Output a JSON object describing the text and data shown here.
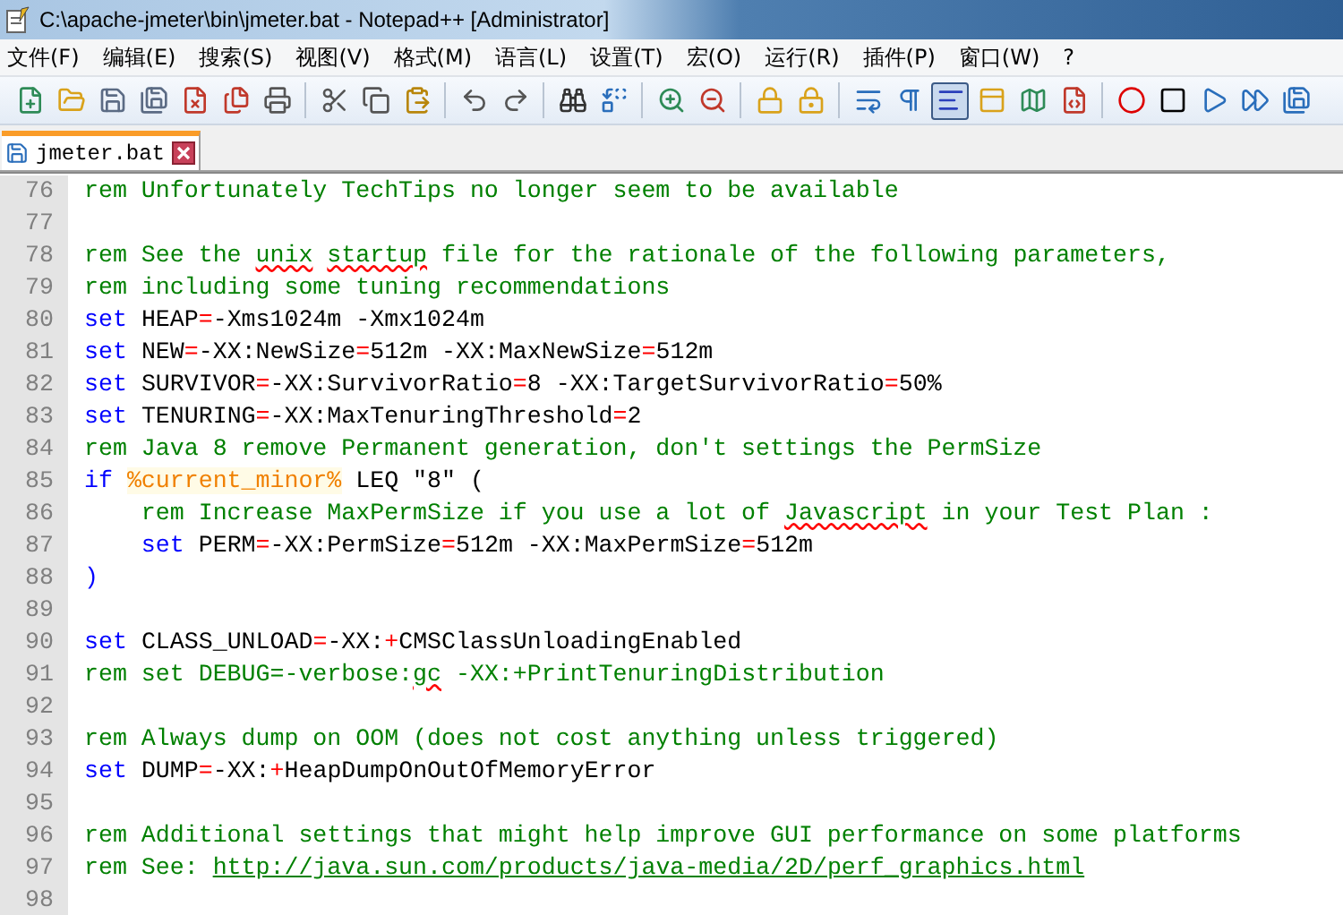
{
  "window": {
    "title": "C:\\apache-jmeter\\bin\\jmeter.bat - Notepad++ [Administrator]"
  },
  "menu": [
    "文件(F)",
    "编辑(E)",
    "搜索(S)",
    "视图(V)",
    "格式(M)",
    "语言(L)",
    "设置(T)",
    "宏(O)",
    "运行(R)",
    "插件(P)",
    "窗口(W)",
    "?"
  ],
  "toolbar": [
    {
      "selected": false
    },
    {
      "selected": false
    },
    {
      "selected": false
    },
    {
      "selected": false
    },
    {
      "selected": false
    },
    {
      "selected": false
    },
    {
      "selected": false
    },
    {
      "selected": false
    },
    {
      "selected": false
    },
    {
      "selected": false
    },
    {
      "selected": false
    },
    {
      "selected": false
    },
    {
      "selected": false
    },
    {
      "selected": false
    },
    {
      "selected": false
    },
    {
      "selected": false
    },
    {
      "selected": false
    },
    {
      "selected": false
    },
    {
      "selected": false
    },
    {
      "selected": false
    },
    {
      "selected": true
    },
    {
      "selected": false
    },
    {
      "selected": false
    },
    {
      "selected": false
    },
    {
      "selected": false
    },
    {
      "selected": false
    },
    {
      "selected": false
    },
    {
      "selected": false
    },
    {
      "selected": false
    }
  ],
  "tabs": [
    {
      "label": "jmeter.bat",
      "selected": true
    }
  ],
  "editor": {
    "lines": [
      {
        "number": "76",
        "tokens": [
          {
            "kind": "comment",
            "text": "rem Unfortunately TechTips no longer seem to be available"
          }
        ]
      },
      {
        "number": "77"
      },
      {
        "number": "78",
        "tokens": [
          {
            "kind": "comment",
            "text": "rem See the "
          },
          {
            "kind": "misspelled",
            "text": "unix"
          },
          {
            "kind": "misspelled",
            "text": " startup"
          },
          {
            "kind": "comment",
            "text": " file for the rationale of the following parameters,"
          }
        ]
      },
      {
        "number": "79",
        "tokens": [
          {
            "kind": "comment",
            "text": "rem including some tuning recommendations"
          }
        ]
      },
      {
        "number": "80",
        "tokens": [
          {
            "kind": "keyword",
            "text": "set"
          },
          {
            "kind": "plain",
            "text": " HEAP"
          },
          {
            "kind": "operator",
            "text": "="
          },
          {
            "kind": "plain",
            "text": "-Xms1024m -Xmx1024m"
          }
        ]
      },
      {
        "number": "81",
        "tokens": [
          {
            "kind": "keyword",
            "text": "set"
          },
          {
            "kind": "plain",
            "text": " NEW"
          },
          {
            "kind": "operator",
            "text": "="
          },
          {
            "kind": "plain",
            "text": "-XX:NewSize"
          },
          {
            "kind": "operator",
            "text": "="
          },
          {
            "kind": "plain",
            "text": "512m -XX:MaxNewSize"
          },
          {
            "kind": "operator",
            "text": "="
          },
          {
            "kind": "plain",
            "text": "512m"
          }
        ]
      },
      {
        "number": "82",
        "tokens": [
          {
            "kind": "keyword",
            "text": "set"
          },
          {
            "kind": "plain",
            "text": " SURVIVOR"
          },
          {
            "kind": "operator",
            "text": "="
          },
          {
            "kind": "plain",
            "text": "-XX:SurvivorRatio"
          },
          {
            "kind": "operator",
            "text": "="
          },
          {
            "kind": "plain",
            "text": "8 -XX:TargetSurvivorRatio"
          },
          {
            "kind": "operator",
            "text": "="
          },
          {
            "kind": "plain",
            "text": "50%"
          }
        ]
      },
      {
        "number": "83",
        "tokens": [
          {
            "kind": "keyword",
            "text": "set"
          },
          {
            "kind": "plain",
            "text": " TENURING"
          },
          {
            "kind": "operator",
            "text": "="
          },
          {
            "kind": "plain",
            "text": "-XX:MaxTenuringThreshold"
          },
          {
            "kind": "operator",
            "text": "="
          },
          {
            "kind": "plain",
            "text": "2"
          }
        ]
      },
      {
        "number": "84",
        "tokens": [
          {
            "kind": "comment",
            "text": "rem Java 8 remove Permanent generation, don't settings the PermSize"
          }
        ]
      },
      {
        "number": "85",
        "tokens": [
          {
            "kind": "keyword",
            "text": "if"
          },
          {
            "kind": "variable",
            "text": " %current_minor%"
          },
          {
            "kind": "plain",
            "text": " LEQ \"8\" ("
          }
        ]
      },
      {
        "number": "86",
        "tokens": [
          {
            "kind": "comment",
            "text": "    rem Increase MaxPermSize if you use a lot of "
          },
          {
            "kind": "misspelled",
            "text": "Javascript"
          },
          {
            "kind": "comment",
            "text": " in your Test Plan :"
          }
        ]
      },
      {
        "number": "87",
        "tokens": [
          {
            "kind": "keyword",
            "text": "    set"
          },
          {
            "kind": "plain",
            "text": " PERM"
          },
          {
            "kind": "operator",
            "text": "="
          },
          {
            "kind": "plain",
            "text": "-XX:PermSize"
          },
          {
            "kind": "operator",
            "text": "="
          },
          {
            "kind": "plain",
            "text": "512m -XX:MaxPermSize"
          },
          {
            "kind": "operator",
            "text": "="
          },
          {
            "kind": "plain",
            "text": "512m"
          }
        ]
      },
      {
        "number": "88",
        "tokens": [
          {
            "kind": "keyword",
            "text": ")"
          }
        ]
      },
      {
        "number": "89"
      },
      {
        "number": "90",
        "tokens": [
          {
            "kind": "keyword",
            "text": "set"
          },
          {
            "kind": "plain",
            "text": " CLASS_UNLOAD"
          },
          {
            "kind": "operator",
            "text": "="
          },
          {
            "kind": "plain",
            "text": "-XX:"
          },
          {
            "kind": "operator",
            "text": "+"
          },
          {
            "kind": "plain",
            "text": "CMSClassUnloadingEnabled"
          }
        ]
      },
      {
        "number": "91",
        "tokens": [
          {
            "kind": "comment",
            "text": "rem set DEBUG=-verbose:"
          },
          {
            "kind": "misspelled",
            "text": "gc"
          },
          {
            "kind": "comment",
            "text": " -XX:+PrintTenuringDistribution"
          }
        ]
      },
      {
        "number": "92"
      },
      {
        "number": "93",
        "tokens": [
          {
            "kind": "comment",
            "text": "rem Always dump on OOM (does not cost anything unless triggered)"
          }
        ]
      },
      {
        "number": "94",
        "tokens": [
          {
            "kind": "keyword",
            "text": "set"
          },
          {
            "kind": "plain",
            "text": " DUMP"
          },
          {
            "kind": "operator",
            "text": "="
          },
          {
            "kind": "plain",
            "text": "-XX:"
          },
          {
            "kind": "operator",
            "text": "+"
          },
          {
            "kind": "plain",
            "text": "HeapDumpOnOutOfMemoryError"
          }
        ]
      },
      {
        "number": "95"
      },
      {
        "number": "96",
        "tokens": [
          {
            "kind": "comment",
            "text": "rem Additional settings that might help improve GUI performance on some platforms"
          }
        ]
      },
      {
        "number": "97",
        "tokens": [
          {
            "kind": "comment",
            "text": "rem See: "
          },
          {
            "kind": "link",
            "text": "http://java.sun.com/products/java-media/2D/perf_graphics.html"
          }
        ]
      },
      {
        "number": "98"
      }
    ]
  }
}
